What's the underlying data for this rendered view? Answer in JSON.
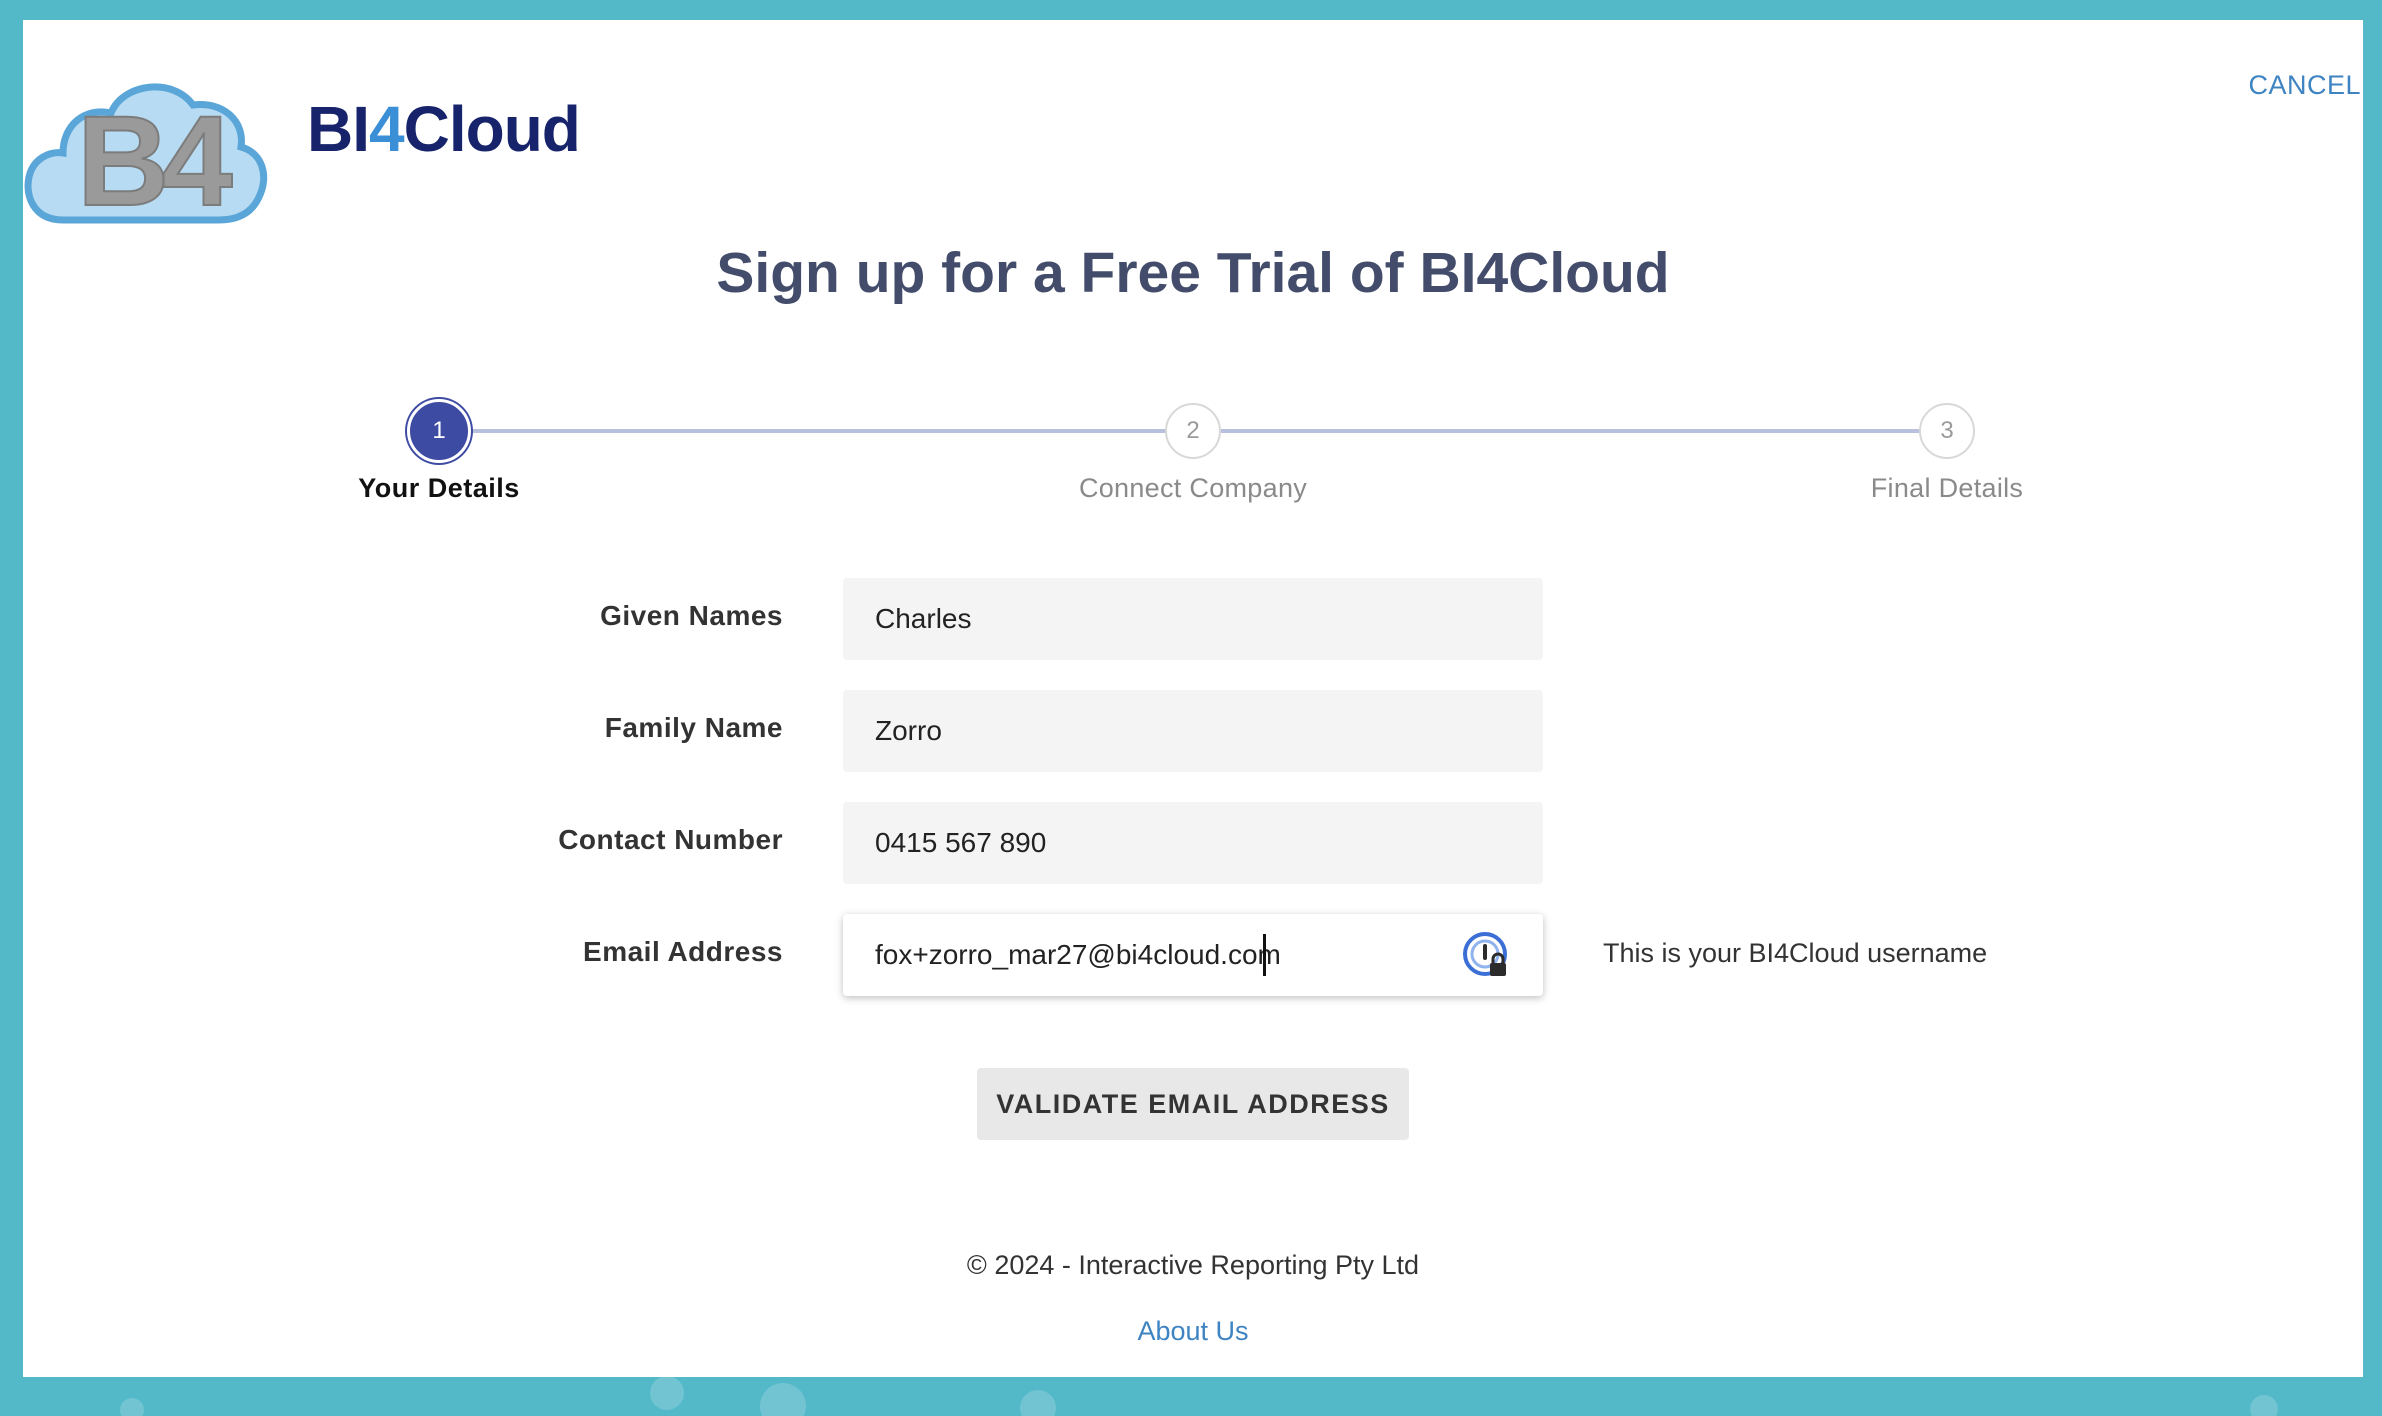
{
  "header": {
    "brand_prefix": "BI",
    "brand_four": "4",
    "brand_suffix": "Cloud",
    "logo_letters": "B4",
    "cancel_label": "CANCEL"
  },
  "title": "Sign up for a Free Trial of BI4Cloud",
  "stepper": {
    "steps": [
      {
        "number": "1",
        "label": "Your Details",
        "state": "active"
      },
      {
        "number": "2",
        "label": "Connect Company",
        "state": "pending"
      },
      {
        "number": "3",
        "label": "Final Details",
        "state": "pending"
      }
    ]
  },
  "form": {
    "given_names": {
      "label": "Given Names",
      "value": "Charles"
    },
    "family_name": {
      "label": "Family Name",
      "value": "Zorro"
    },
    "contact_number": {
      "label": "Contact Number",
      "value": "0415 567 890"
    },
    "email": {
      "label": "Email Address",
      "value": "fox+zorro_mar27@bi4cloud.com",
      "hint": "This is your BI4Cloud username"
    }
  },
  "validate_button": "VALIDATE EMAIL ADDRESS",
  "footer": {
    "copyright": "© 2024 - Interactive Reporting Pty Ltd",
    "about_link": "About Us"
  },
  "colors": {
    "background": "#53b8c8",
    "primary": "#3d4ba3",
    "brand_dark": "#17236b",
    "link": "#3e83c2"
  },
  "icons": {
    "password_manager": "password-manager-icon"
  }
}
